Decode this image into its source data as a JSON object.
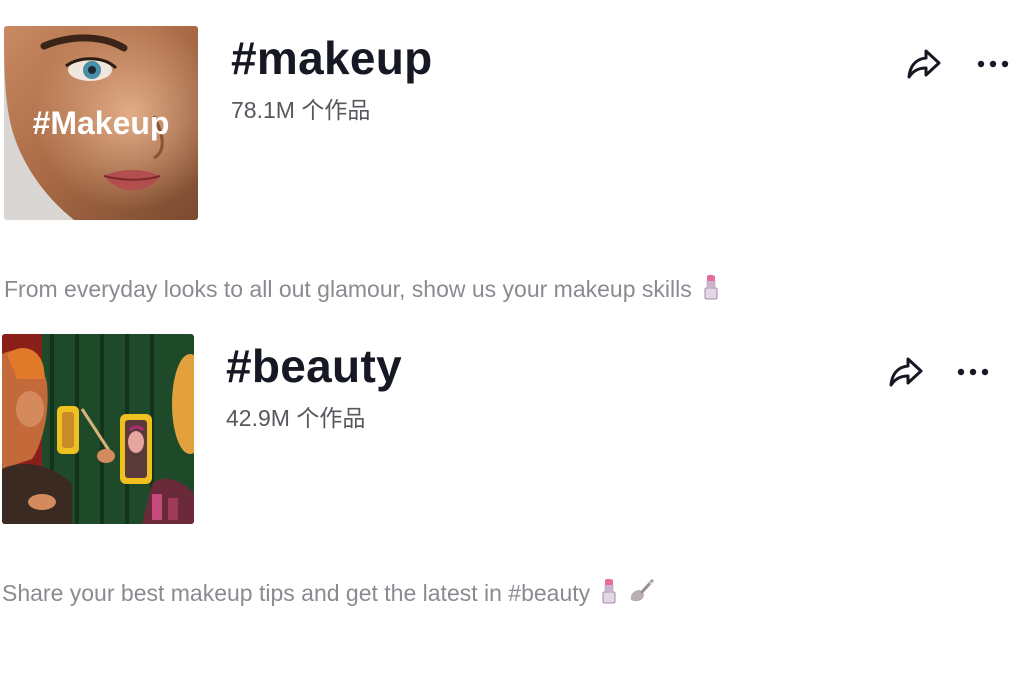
{
  "hashtags": [
    {
      "title": "#makeup",
      "count": "78.1M 个作品",
      "thumb_text": "#Makeup",
      "description": "From everyday looks to all out glamour, show us your makeup skills",
      "description_emojis": [
        "lipstick-emoji"
      ]
    },
    {
      "title": "#beauty",
      "count": "42.9M 个作品",
      "description": "Share your best makeup tips and get the latest in #beauty",
      "description_emojis": [
        "lipstick-emoji",
        "makeup-brush-emoji"
      ]
    }
  ],
  "colors": {
    "title": "#161823",
    "count": "#57585e",
    "description": "#8a8b91"
  },
  "icons": [
    "share-icon",
    "more-icon"
  ]
}
